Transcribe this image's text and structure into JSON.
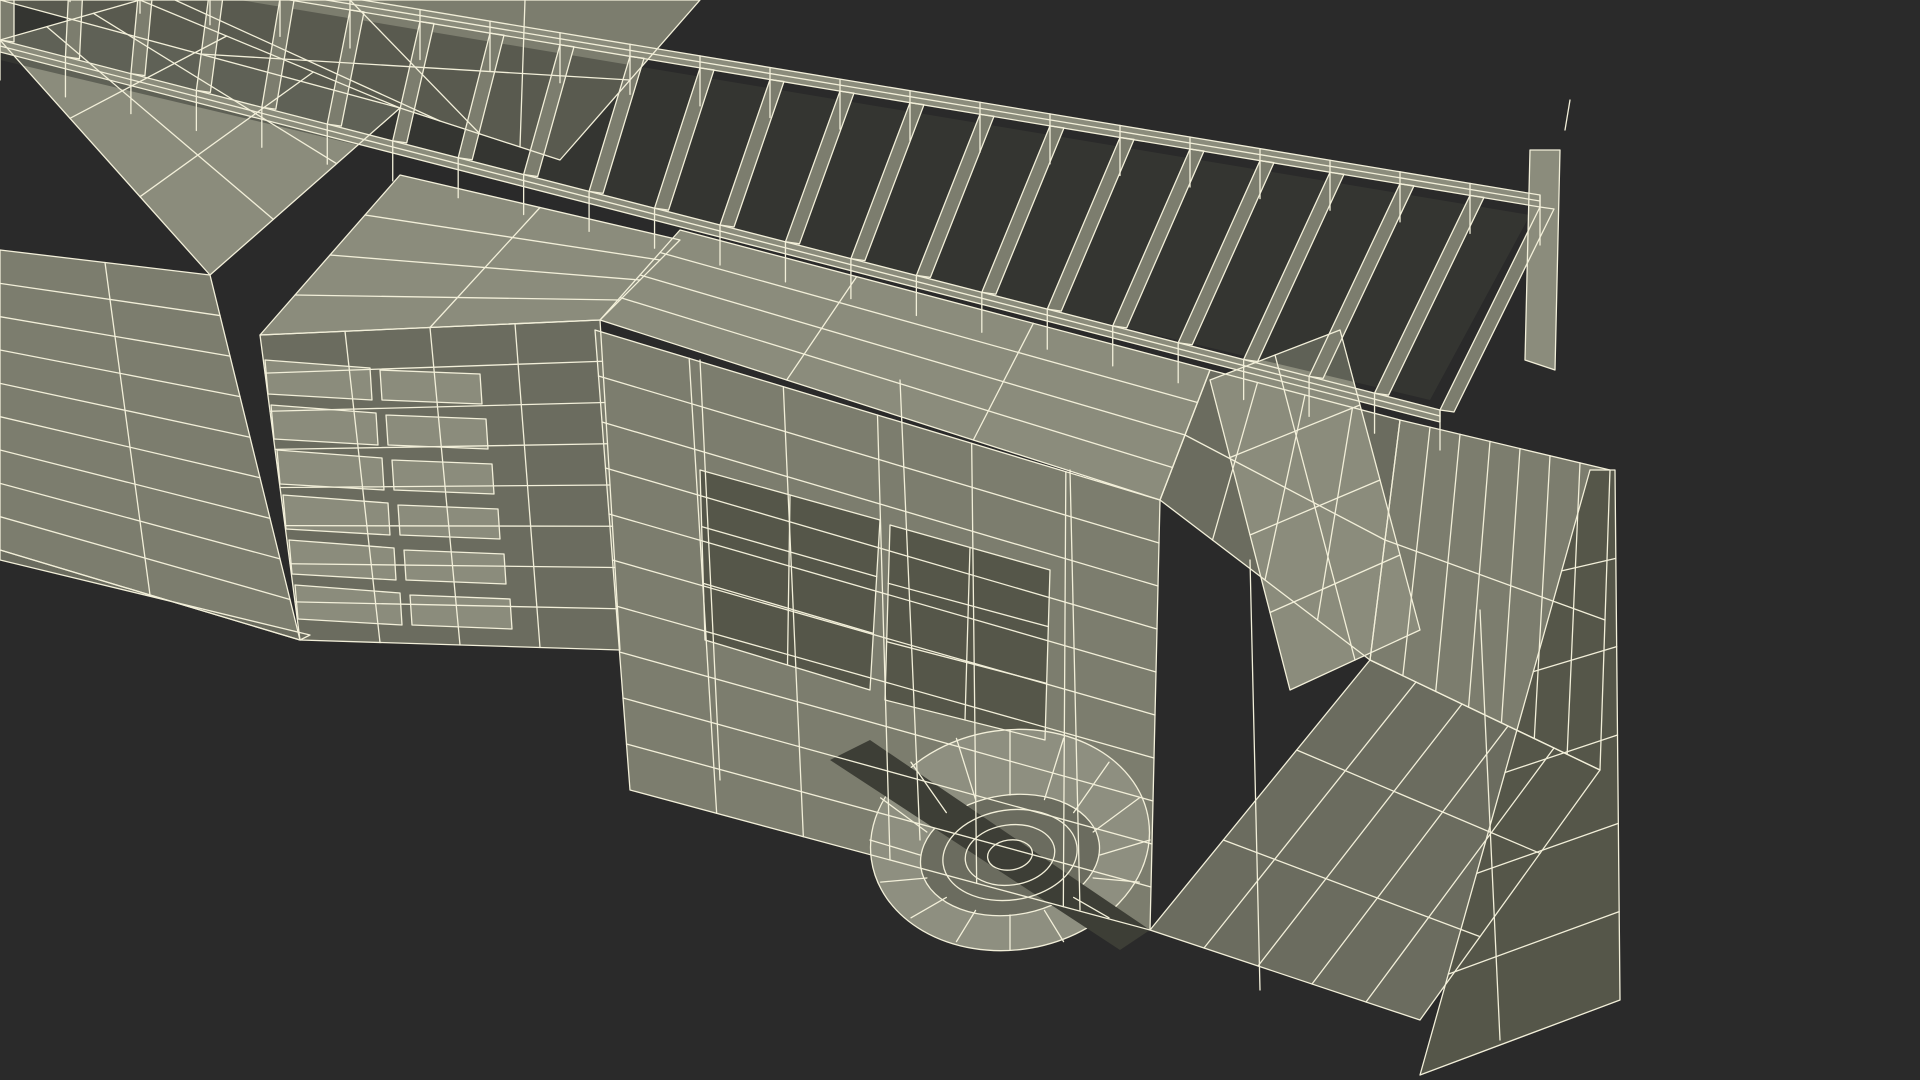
{
  "scene": {
    "subject": "fire-truck-wireframe-model",
    "colors": {
      "background": "#2a2a2a",
      "mesh_light": "#8b8c7c",
      "mesh_mid": "#7c7d6e",
      "mesh_dark": "#6b6c5f",
      "mesh_shadow": "#555649",
      "tire": "#8e8f80",
      "wire": "#f2efd9",
      "edge_shadow": "#3d3e36"
    }
  }
}
